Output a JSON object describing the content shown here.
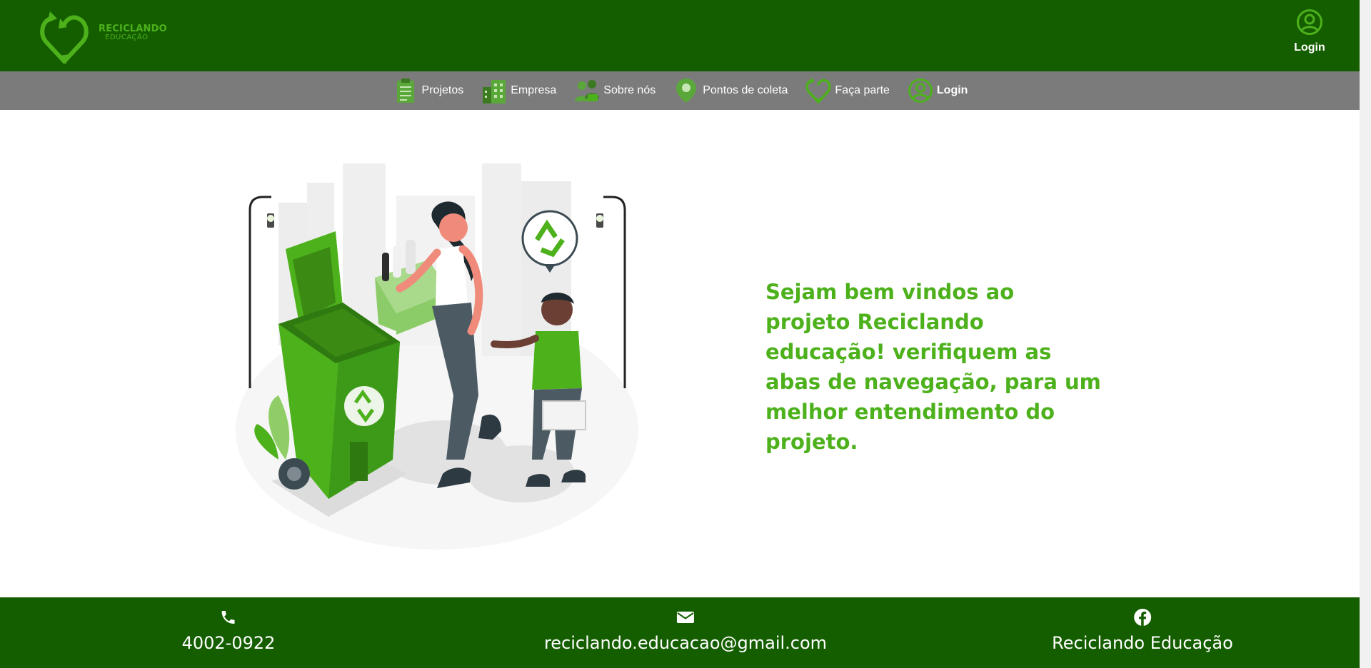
{
  "brand": {
    "title": "RECICLANDO",
    "subtitle": "EDUCAÇÃO",
    "colors": {
      "primary_dark": "#145e00",
      "accent": "#4db11c",
      "nav_bg": "#7b7b7b"
    }
  },
  "header": {
    "login_label": "Login",
    "login_icon": "user-circle-icon"
  },
  "nav": {
    "items": [
      {
        "label": "Projetos",
        "icon": "clipboard-icon"
      },
      {
        "label": "Empresa",
        "icon": "buildings-icon"
      },
      {
        "label": "Sobre nós",
        "icon": "people-icon"
      },
      {
        "label": "Pontos de coleta",
        "icon": "map-pin-icon"
      },
      {
        "label": "Faça parte",
        "icon": "recycle-heart-icon"
      },
      {
        "label": "Login",
        "icon": "user-circle-icon"
      }
    ]
  },
  "hero": {
    "illustration": "woman-and-child-recycling-illustration",
    "welcome_text": "Sejam bem vindos ao projeto Reciclando educação! verifiquem as abas de navegação, para um melhor entendimento do projeto."
  },
  "footer": {
    "phone": {
      "icon": "phone-icon",
      "text": "4002-0922"
    },
    "email": {
      "icon": "envelope-icon",
      "text": "reciclando.educacao@gmail.com"
    },
    "facebook": {
      "icon": "facebook-icon",
      "text": "Reciclando Educação"
    }
  }
}
